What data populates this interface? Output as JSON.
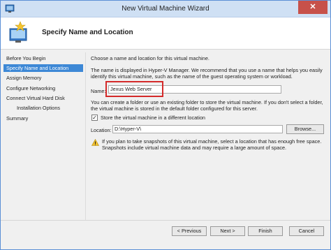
{
  "window": {
    "title": "New Virtual Machine Wizard",
    "close_glyph": "✕"
  },
  "header": {
    "heading": "Specify Name and Location",
    "icon": "virtual-machine-wizard-icon"
  },
  "nav": {
    "items": [
      {
        "label": "Before You Begin"
      },
      {
        "label": "Specify Name and Location"
      },
      {
        "label": "Assign Memory"
      },
      {
        "label": "Configure Networking"
      },
      {
        "label": "Connect Virtual Hard Disk"
      },
      {
        "label": "Installation Options"
      },
      {
        "label": "Summary"
      }
    ],
    "active_index": 1
  },
  "content": {
    "intro": "Choose a name and location for this virtual machine.",
    "description": "The name is displayed in Hyper-V Manager. We recommend that you use a name that helps you easily identify this virtual machine, such as the name of the guest operating system or workload.",
    "name_label": "Name:",
    "name_value": "Jexus Web Server",
    "folder_info": "You can create a folder or use an existing folder to store the virtual machine. If you don't select a folder, the virtual machine is stored in the default folder configured for this server.",
    "store_checkbox_label": "Store the virtual machine in a different location",
    "store_checked": true,
    "location_label": "Location:",
    "location_value": "D:\\Hyper-V\\",
    "browse_label": "Browse...",
    "warning": "If you plan to take snapshots of this virtual machine, select a location that has enough free space. Snapshots include virtual machine data and may require a large amount of space."
  },
  "buttons": {
    "previous": "< Previous",
    "next": "Next >",
    "finish": "Finish",
    "cancel": "Cancel"
  },
  "colors": {
    "nav_active": "#3d88d6",
    "highlight_box": "#d42a2a",
    "close_button": "#c7514a"
  }
}
